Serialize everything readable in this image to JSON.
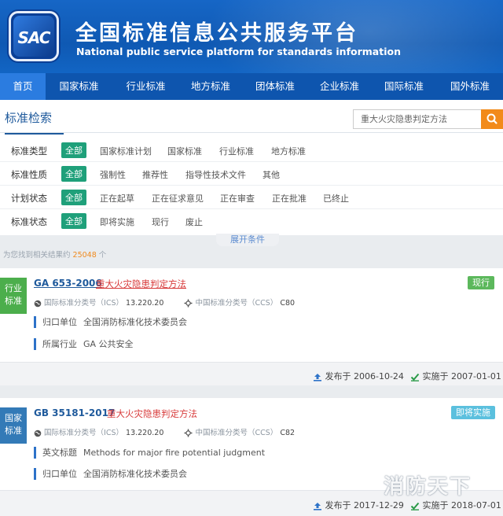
{
  "header": {
    "logo_text": "SAC",
    "title_cn": "全国标准信息公共服务平台",
    "title_en": "National public service platform  for standards information"
  },
  "nav": [
    "首页",
    "国家标准",
    "行业标准",
    "地方标准",
    "团体标准",
    "企业标准",
    "国际标准",
    "国外标准"
  ],
  "search": {
    "title": "标准检索",
    "query": "重大火灾隐患判定方法"
  },
  "filters": [
    {
      "label": "标准类型",
      "options": [
        "全部",
        "国家标准计划",
        "国家标准",
        "行业标准",
        "地方标准"
      ]
    },
    {
      "label": "标准性质",
      "options": [
        "全部",
        "强制性",
        "推荐性",
        "指导性技术文件",
        "其他"
      ]
    },
    {
      "label": "计划状态",
      "options": [
        "全部",
        "正在起草",
        "正在征求意见",
        "正在审查",
        "正在批准",
        "已终止"
      ]
    },
    {
      "label": "标准状态",
      "options": [
        "全部",
        "即将实施",
        "现行",
        "废止"
      ]
    }
  ],
  "expand_label": "展开条件",
  "result_count": {
    "prefix": "为您找到相关结果约 ",
    "count": "25048",
    "suffix": " 个"
  },
  "results": [
    {
      "category": "行业标准",
      "category_color": "#4cae4c",
      "code": "GA 653-2006",
      "name": "重大火灾隐患判定方法",
      "status": "现行",
      "status_color": "#5cb85c",
      "ics_label": "国际标准分类号（ICS）",
      "ics": "13.220.20",
      "ccs_label": "中国标准分类号（CCS）",
      "ccs": "C80",
      "info": [
        {
          "key": "归口单位",
          "value": "全国消防标准化技术委员会"
        },
        {
          "key": "所属行业",
          "value": "GA 公共安全"
        }
      ],
      "publish": "发布于 2006-10-24",
      "implement": "实施于 2007-01-01"
    },
    {
      "category": "国家标准",
      "category_color": "#337ab7",
      "code": "GB 35181-2017",
      "name": "重大火灾隐患判定方法",
      "status": "即将实施",
      "status_color": "#5bc0de",
      "ics_label": "国际标准分类号（ICS）",
      "ics": "13.220.20",
      "ccs_label": "中国标准分类号（CCS）",
      "ccs": "C82",
      "info": [
        {
          "key": "英文标题",
          "value": "Methods for major fire potential judgment"
        },
        {
          "key": "归口单位",
          "value": "全国消防标准化技术委员会"
        }
      ],
      "publish": "发布于 2017-12-29",
      "implement": "实施于 2018-07-01"
    }
  ],
  "watermark": "消防天下"
}
